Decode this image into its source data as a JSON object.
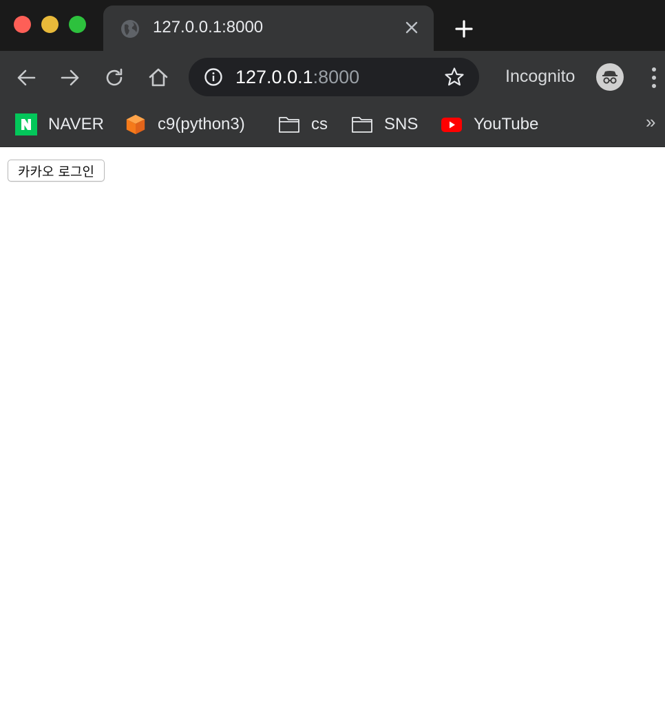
{
  "browser": {
    "tab": {
      "title": "127.0.0.1:8000"
    },
    "toolbar": {
      "url_host": "127.0.0.1",
      "url_port": ":8000",
      "incognito_label": "Incognito"
    },
    "bookmarks": [
      {
        "label": "NAVER",
        "icon": "naver-icon"
      },
      {
        "label": "c9(python3)",
        "icon": "cube-icon"
      },
      {
        "label": "cs",
        "icon": "folder-icon"
      },
      {
        "label": "SNS",
        "icon": "folder-icon"
      },
      {
        "label": "YouTube",
        "icon": "youtube-icon"
      }
    ],
    "overflow_label": "»",
    "colors": {
      "tabstrip": "#1a1a1a",
      "toolbar": "#353637",
      "omnibox": "#202124",
      "naver_green": "#03c75a",
      "youtube_red": "#ff0000"
    }
  },
  "page": {
    "kakao_login_label": "카카오 로그인"
  }
}
